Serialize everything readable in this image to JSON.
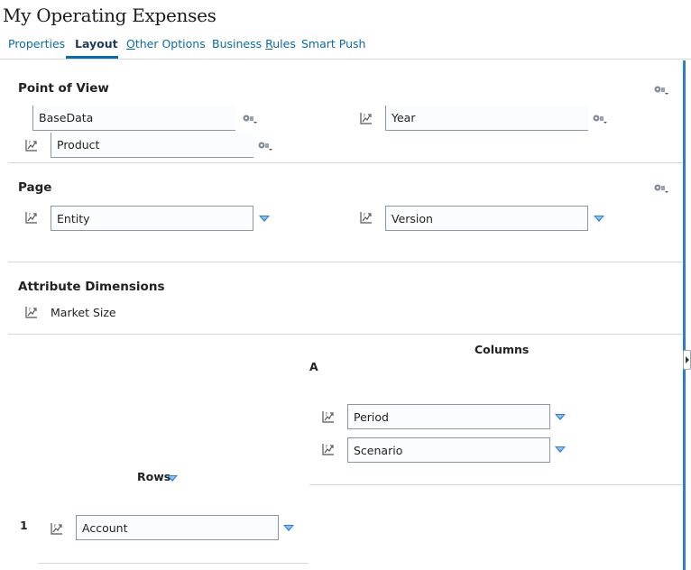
{
  "page_title": "My Operating Expenses",
  "tabs": [
    {
      "label": "Properties"
    },
    {
      "label": "Layout"
    },
    {
      "label_pre": "",
      "label_u": "O",
      "label_post": "ther Options"
    },
    {
      "label_pre": "Business ",
      "label_u": "R",
      "label_post": "ules"
    },
    {
      "label": "Smart Push"
    }
  ],
  "pov": {
    "title": "Point of View",
    "fields": [
      "BaseData",
      "Year",
      "Product"
    ]
  },
  "page_section": {
    "title": "Page",
    "fields": [
      "Entity",
      "Version"
    ]
  },
  "attribute_dimensions": {
    "title": "Attribute Dimensions",
    "items": [
      "Market Size"
    ]
  },
  "columns": {
    "title": "Columns",
    "group_label": "A",
    "fields": [
      "Period",
      "Scenario"
    ]
  },
  "rows": {
    "title": "Rows",
    "row_number": "1",
    "fields": [
      "Account"
    ]
  },
  "colors": {
    "accent": "#0b6aa8",
    "dropdown_arrow": "#2d7dd2"
  }
}
